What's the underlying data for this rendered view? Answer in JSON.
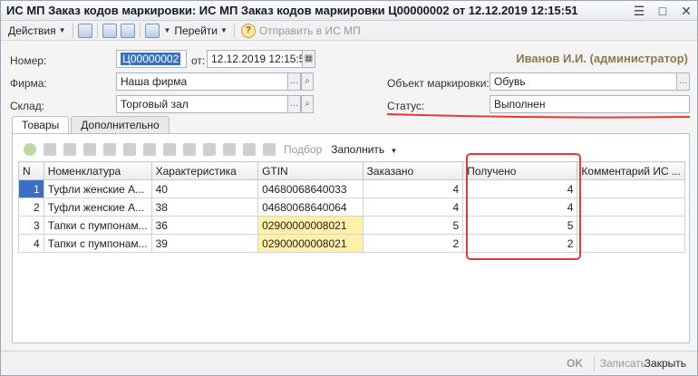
{
  "window": {
    "title": "ИС МП Заказ кодов маркировки: ИС МП Заказ кодов маркировки Ц00000002 от 12.12.2019 12:15:51"
  },
  "toolbar": {
    "actions_label": "Действия",
    "goto_label": "Перейти",
    "send_label": "Отправить в ИС МП"
  },
  "user": "Иванов И.И. (администратор)",
  "form": {
    "number_label": "Номер:",
    "number_value": "Ц00000002",
    "date_label": "от:",
    "date_value": "12.12.2019 12:15:51",
    "firm_label": "Фирма:",
    "firm_value": "Наша фирма",
    "warehouse_label": "Склад:",
    "warehouse_value": "Торговый зал",
    "object_label": "Объект маркировки:",
    "object_value": "Обувь",
    "status_label": "Статус:",
    "status_value": "Выполнен"
  },
  "tabs": [
    "Товары",
    "Дополнительно"
  ],
  "table_toolbar": {
    "selection_label": "Подбор",
    "fill_label": "Заполнить"
  },
  "table": {
    "headers": [
      "N",
      "Номенклатура",
      "Характеристика",
      "GTIN",
      "Заказано",
      "Получено",
      "Комментарий ИС ..."
    ],
    "rows": [
      {
        "n": "1",
        "nomenclature": "Туфли  женские А...",
        "characteristic": "40",
        "gtin": "04680068640033",
        "ordered": "4",
        "received": "4",
        "comment": ""
      },
      {
        "n": "2",
        "nomenclature": "Туфли  женские А...",
        "characteristic": "38",
        "gtin": "04680068640064",
        "ordered": "4",
        "received": "4",
        "comment": ""
      },
      {
        "n": "3",
        "nomenclature": "Тапки с пумпонам...",
        "characteristic": "36",
        "gtin": "02900000008021",
        "ordered": "5",
        "received": "5",
        "comment": ""
      },
      {
        "n": "4",
        "nomenclature": "Тапки с пумпонам...",
        "characteristic": "39",
        "gtin": "02900000008021",
        "ordered": "2",
        "received": "2",
        "comment": ""
      }
    ]
  },
  "footer": {
    "ok_label": "OK",
    "save_label": "Записать",
    "close_label": "Закрыть"
  }
}
